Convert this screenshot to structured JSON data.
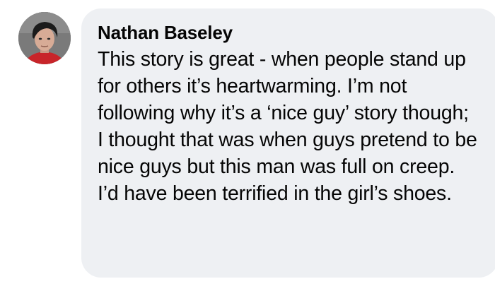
{
  "comment": {
    "author": "Nathan Baseley",
    "text": "This story is great - when people stand up for others it’s heartwarming. I’m not following why it’s a ‘nice guy’ story though; I thought that was when guys pretend to be nice guys but this man was full on creep. I’d have been terrified in the girl’s shoes.",
    "avatar_icon": "profile-photo"
  },
  "colors": {
    "bubble_background": "#eef0f3",
    "text": "#050505",
    "page_background": "#ffffff"
  }
}
